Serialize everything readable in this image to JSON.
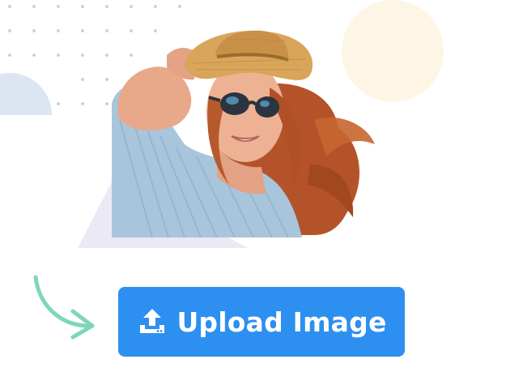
{
  "upload_button": {
    "label": "Upload Image",
    "icon": "upload-icon",
    "color": "#2d8ff0",
    "text_color": "#ffffff"
  },
  "hero_image": {
    "subject": "woman-in-straw-hat-and-sunglasses"
  },
  "decorations": {
    "arrow_color": "#7fd6b8",
    "yellow_circle_color": "#fdf6e4",
    "blue_shape_color": "#dbe6f2",
    "triangle_color": "#ece9f6",
    "dot_color": "#c9d3de"
  }
}
